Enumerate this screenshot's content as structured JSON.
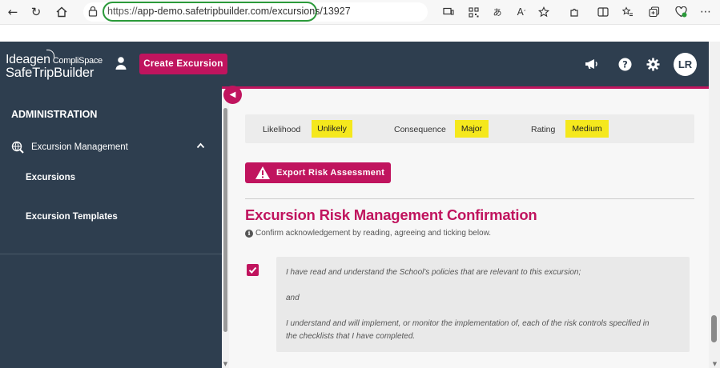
{
  "browser": {
    "url_scheme": "https://",
    "url_rest": "app-demo.safetripbuilder.com/excursions/13927"
  },
  "header": {
    "logo_brand": "Ideagen",
    "logo_sub": "CompliSpace",
    "logo_product": "SafeTripBuilder",
    "create_button": "Create Excursion",
    "avatar_initials": "LR"
  },
  "sidebar": {
    "heading": "ADMINISTRATION",
    "group_label": "Excursion Management",
    "items": [
      "Excursions",
      "Excursion Templates"
    ]
  },
  "risk": {
    "likelihood_label": "Likelihood",
    "likelihood_value": "Unlikely",
    "consequence_label": "Consequence",
    "consequence_value": "Major",
    "rating_label": "Rating",
    "rating_value": "Medium",
    "highlight_color": "#f5e81d"
  },
  "export_button": "Export Risk Assessment",
  "confirmation": {
    "title": "Excursion Risk Management Confirmation",
    "subtitle": "Confirm acknowledgement by reading, agreeing and ticking below.",
    "checked": true,
    "lines": [
      "I have read and understand the School's policies that are relevant to this excursion;",
      "and",
      "I understand and will implement, or monitor the implementation of, each of the risk controls specified in",
      "the checklists that I have completed."
    ]
  },
  "colors": {
    "brand": "#c0145e",
    "header_bg": "#2e3e4f",
    "url_highlight": "#2b9a3a"
  }
}
